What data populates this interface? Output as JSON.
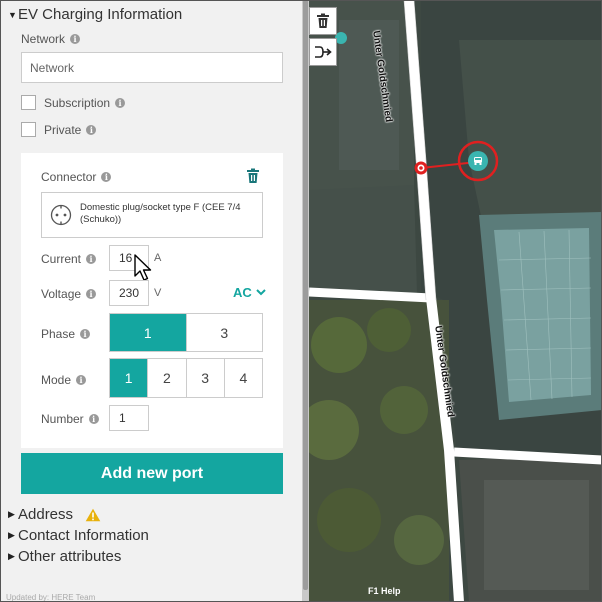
{
  "panel": {
    "ev_section_title": "EV Charging Information",
    "network": {
      "label": "Network",
      "placeholder": "Network"
    },
    "subscription_label": "Subscription",
    "private_label": "Private",
    "connector": {
      "label": "Connector",
      "type_text": "Domestic plug/socket type F (CEE 7/4 (Schuko))",
      "current": {
        "label": "Current",
        "value": "16",
        "unit": "A"
      },
      "voltage": {
        "label": "Voltage",
        "value": "230",
        "unit": "V",
        "current_type": "AC"
      },
      "phase": {
        "label": "Phase",
        "options": [
          "1",
          "3"
        ],
        "selected": "1"
      },
      "mode": {
        "label": "Mode",
        "options": [
          "1",
          "2",
          "3",
          "4"
        ],
        "selected": "1"
      },
      "number": {
        "label": "Number",
        "value": "1"
      }
    },
    "add_port_label": "Add new port",
    "sections": {
      "address": "Address",
      "contact": "Contact Information",
      "other": "Other attributes"
    },
    "footer": "Updated by: HERE Team"
  },
  "map": {
    "street_top": "Unter Goldschmied",
    "street_bottom": "Unter Goldschmied",
    "help_hint": "F1 Help",
    "colors": {
      "accent": "#14a6a0",
      "poi": "#3ab5b0",
      "selection": "#e02020",
      "road": "#ffffff"
    }
  },
  "icons": {
    "trash": "trash-icon",
    "split": "split-icon",
    "warning": "warning-icon",
    "chevron": "chevron-down-icon",
    "plug": "plug-icon",
    "poi": "ev-charging-poi-icon"
  }
}
